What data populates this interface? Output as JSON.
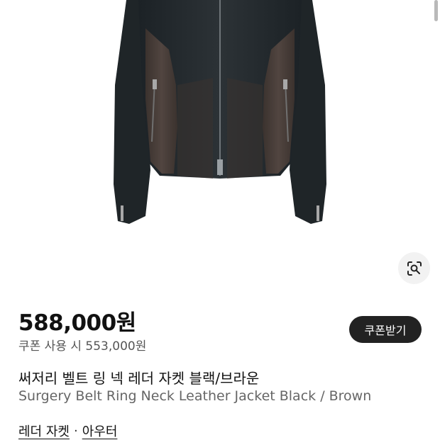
{
  "product": {
    "price": "588,000원",
    "coupon_price": "쿠폰 사용 시 553,000원",
    "coupon_button_label": "쿠폰받기",
    "title_ko": "써저리 벨트 링 넥 레더 자켓 블랙/브라운",
    "title_en": "Surgery Belt Ring Neck Leather Jacket Black / Brown",
    "categories": [
      "레더 자켓",
      "아우터"
    ],
    "category_separator": "·"
  },
  "colors": {
    "jacket_black": "#24292c",
    "jacket_brown": "#463b36",
    "coupon_button": "#222222",
    "lens_button_bg": "#f2f2f2"
  },
  "icons": {
    "lens": "image-search-icon"
  }
}
